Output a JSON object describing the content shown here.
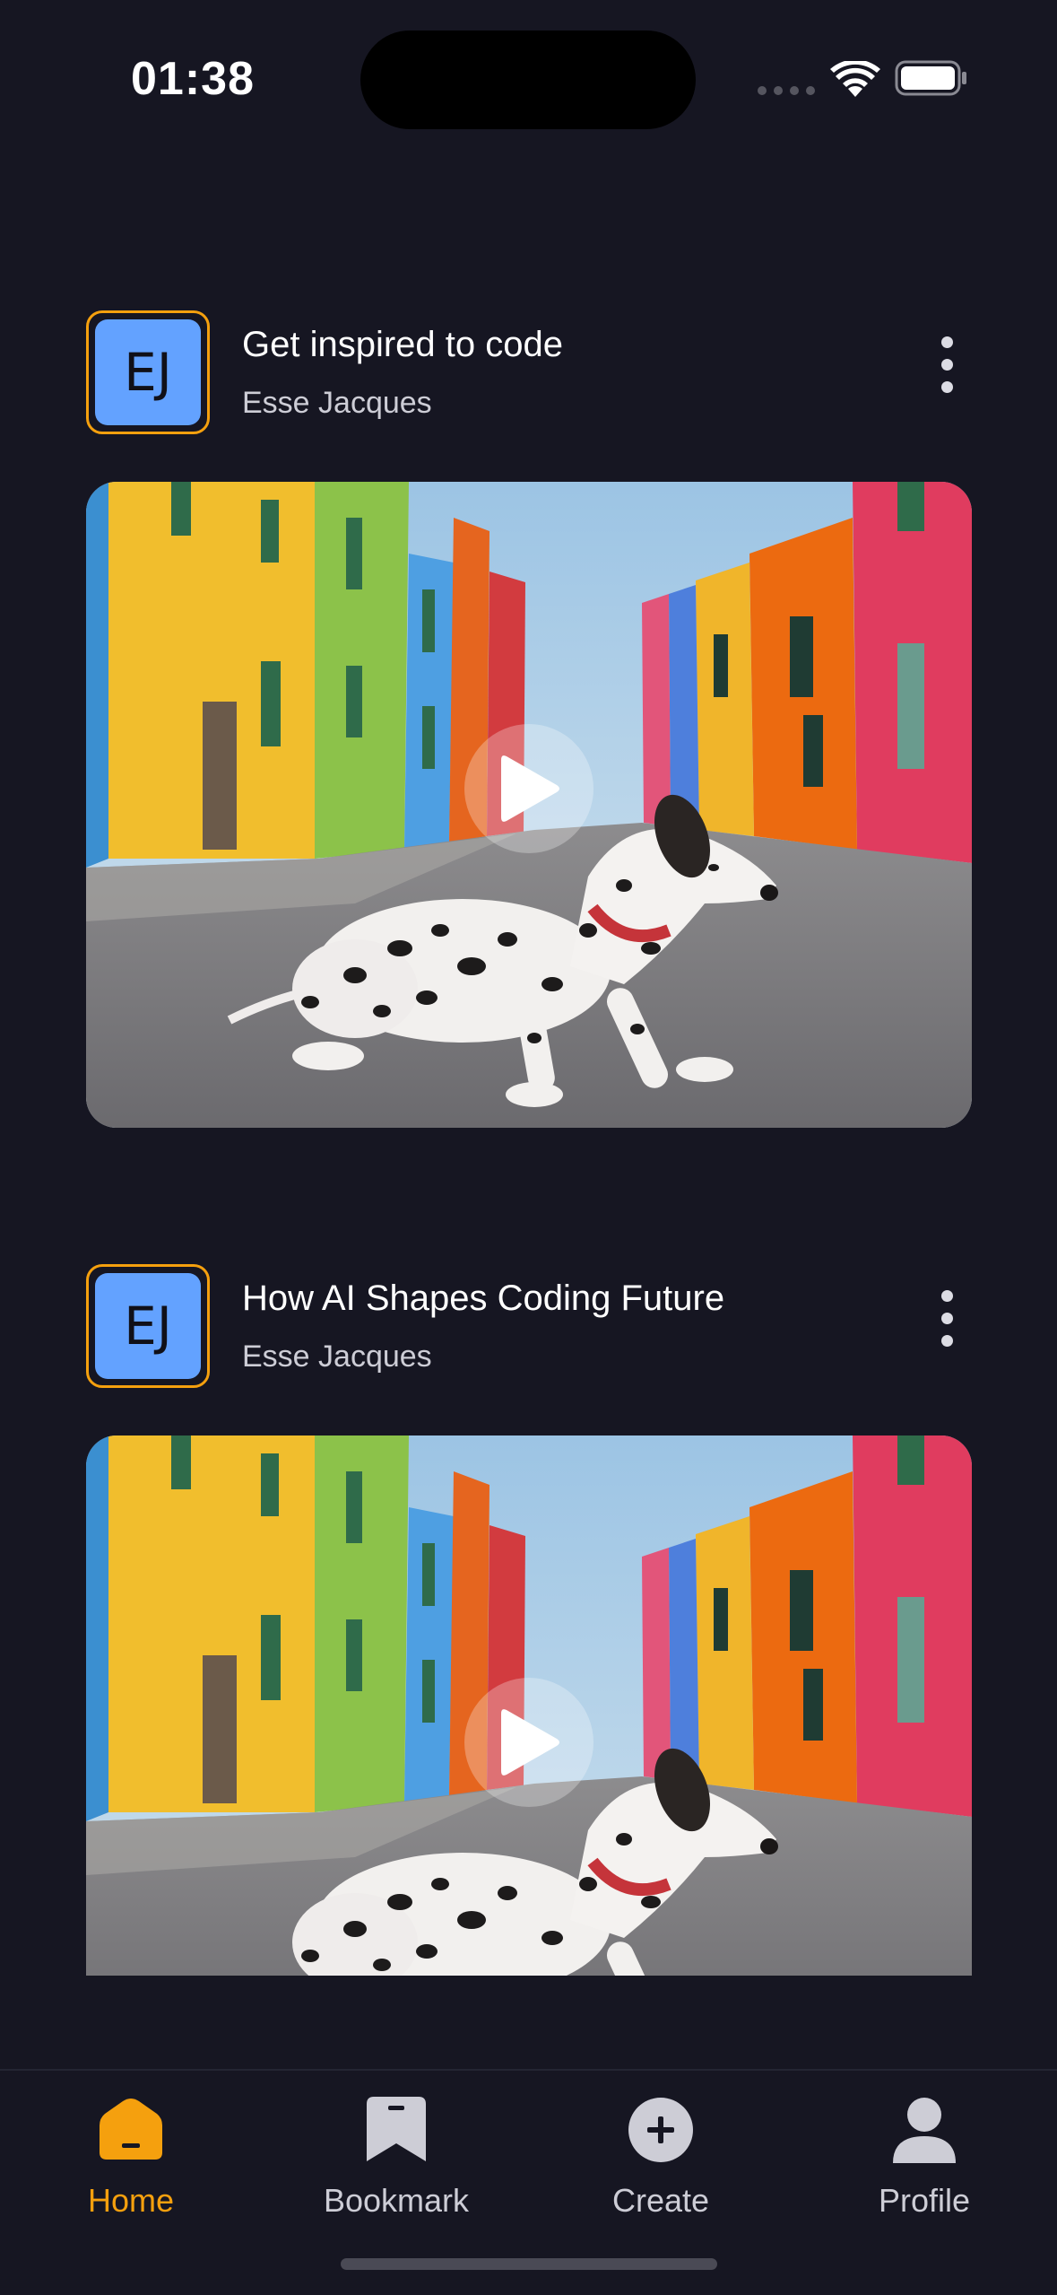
{
  "status_bar": {
    "time": "01:38"
  },
  "posts": [
    {
      "avatar_initials": "EJ",
      "title": "Get inspired to code",
      "author": "Esse Jacques",
      "media_type": "video"
    },
    {
      "avatar_initials": "EJ",
      "title": "How AI Shapes Coding Future",
      "author": "Esse Jacques",
      "media_type": "video"
    }
  ],
  "tab_bar": {
    "tabs": [
      {
        "label": "Home",
        "icon": "home-icon",
        "active": true
      },
      {
        "label": "Bookmark",
        "icon": "bookmark-icon",
        "active": false
      },
      {
        "label": "Create",
        "icon": "plus-circle-icon",
        "active": false
      },
      {
        "label": "Profile",
        "icon": "person-icon",
        "active": false
      }
    ]
  },
  "colors": {
    "background": "#161622",
    "accent": "#f5a00e",
    "avatar_fill": "#63a2ff",
    "inactive": "#cdcdd6"
  }
}
